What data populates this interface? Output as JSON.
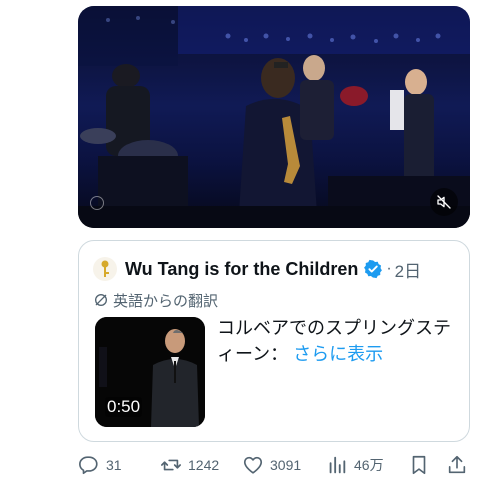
{
  "video": {
    "mute_icon": "speaker-muted-icon",
    "scene": "live band performance on stage with saxophone player"
  },
  "quote": {
    "author_name": "Wu Tang is for the Children",
    "verified": true,
    "dot": "·",
    "time": "2日",
    "translate_label": "英語からの翻訳",
    "text": "コルベアでのスプリングスティーン：",
    "more_label": "さらに表示",
    "video_duration": "0:50"
  },
  "actions": {
    "replies": "31",
    "reposts": "1242",
    "likes": "3091",
    "views": "46万"
  },
  "colors": {
    "link": "#1d9bf0",
    "muted_text": "#536471",
    "border": "#cfd9de",
    "verified": "#1d9bf0"
  }
}
